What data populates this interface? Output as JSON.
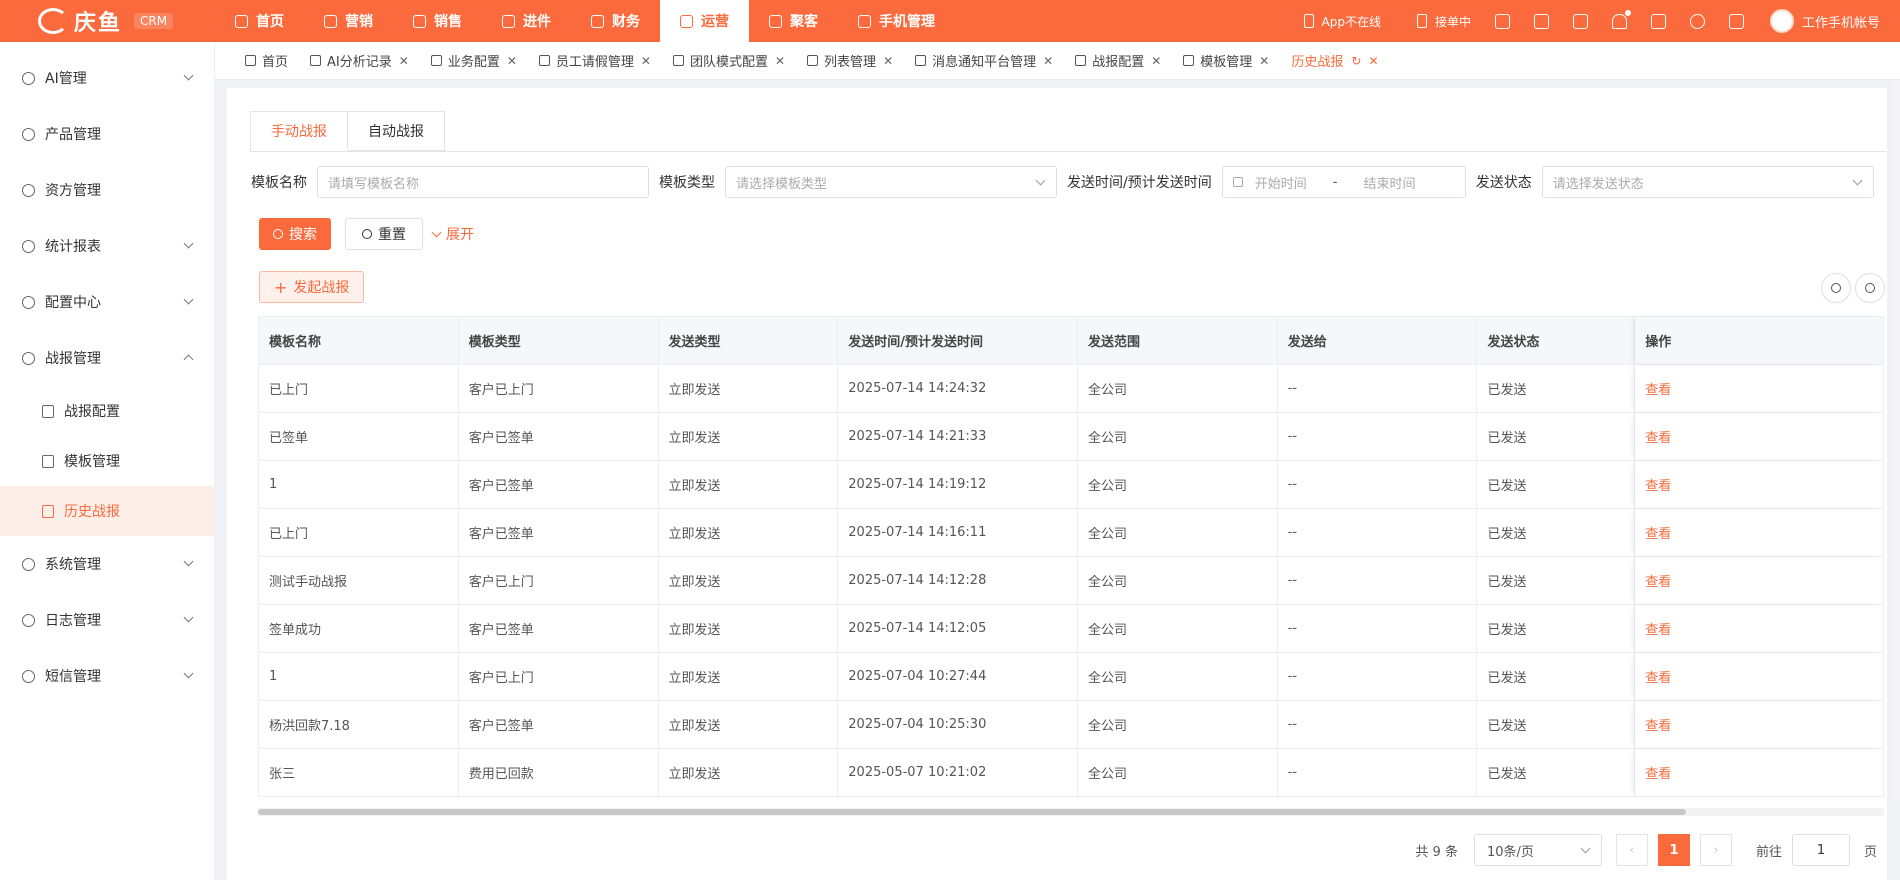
{
  "app": {
    "logo_text": "庆鱼",
    "badge": "CRM"
  },
  "topnav": [
    {
      "label": "首页"
    },
    {
      "label": "营销"
    },
    {
      "label": "销售"
    },
    {
      "label": "进件"
    },
    {
      "label": "财务"
    },
    {
      "label": "运营"
    },
    {
      "label": "聚客"
    },
    {
      "label": "手机管理"
    }
  ],
  "topright": {
    "app_status": "App不在线",
    "order_status": "接单中",
    "account": "工作手机帐号"
  },
  "sidebar": {
    "items": [
      {
        "label": "AI管理"
      },
      {
        "label": "产品管理"
      },
      {
        "label": "资方管理"
      },
      {
        "label": "统计报表"
      },
      {
        "label": "配置中心"
      },
      {
        "label": "战报管理"
      }
    ],
    "sub_items": [
      {
        "label": "战报配置"
      },
      {
        "label": "模板管理"
      },
      {
        "label": "历史战报"
      }
    ],
    "bottom_items": [
      {
        "label": "系统管理"
      },
      {
        "label": "日志管理"
      },
      {
        "label": "短信管理"
      }
    ]
  },
  "page_tabs": [
    {
      "label": "首页"
    },
    {
      "label": "AI分析记录"
    },
    {
      "label": "业务配置"
    },
    {
      "label": "员工请假管理"
    },
    {
      "label": "团队模式配置"
    },
    {
      "label": "列表管理"
    },
    {
      "label": "消息通知平台管理"
    },
    {
      "label": "战报配置"
    },
    {
      "label": "模板管理"
    },
    {
      "label": "历史战报"
    }
  ],
  "subtabs": {
    "manual": "手动战报",
    "auto": "自动战报"
  },
  "filters": {
    "template_name_label": "模板名称",
    "template_name_placeholder": "请填写模板名称",
    "template_type_label": "模板类型",
    "template_type_placeholder": "请选择模板类型",
    "time_label": "发送时间/预计发送时间",
    "start_placeholder": "开始时间",
    "separator": "-",
    "end_placeholder": "结束时间",
    "status_label": "发送状态",
    "status_placeholder": "请选择发送状态"
  },
  "buttons": {
    "search": "搜索",
    "reset": "重置",
    "expand": "展开",
    "launch": "发起战报"
  },
  "table": {
    "headers": [
      "模板名称",
      "模板类型",
      "发送类型",
      "发送时间/预计发送时间",
      "发送范围",
      "发送给",
      "发送状态",
      "操作"
    ],
    "rows": [
      [
        "已上门",
        "客户已上门",
        "立即发送",
        "2025-07-14 14:24:32",
        "全公司",
        "--",
        "已发送",
        "查看"
      ],
      [
        "已签单",
        "客户已签单",
        "立即发送",
        "2025-07-14 14:21:33",
        "全公司",
        "--",
        "已发送",
        "查看"
      ],
      [
        "1",
        "客户已签单",
        "立即发送",
        "2025-07-14 14:19:12",
        "全公司",
        "--",
        "已发送",
        "查看"
      ],
      [
        "已上门",
        "客户已签单",
        "立即发送",
        "2025-07-14 14:16:11",
        "全公司",
        "--",
        "已发送",
        "查看"
      ],
      [
        "测试手动战报",
        "客户已上门",
        "立即发送",
        "2025-07-14 14:12:28",
        "全公司",
        "--",
        "已发送",
        "查看"
      ],
      [
        "签单成功",
        "客户已签单",
        "立即发送",
        "2025-07-14 14:12:05",
        "全公司",
        "--",
        "已发送",
        "查看"
      ],
      [
        "1",
        "客户已上门",
        "立即发送",
        "2025-07-04 10:27:44",
        "全公司",
        "--",
        "已发送",
        "查看"
      ],
      [
        "杨洪回款7.18",
        "客户已签单",
        "立即发送",
        "2025-07-04 10:25:30",
        "全公司",
        "--",
        "已发送",
        "查看"
      ],
      [
        "张三",
        "费用已回款",
        "立即发送",
        "2025-05-07 10:21:02",
        "全公司",
        "--",
        "已发送",
        "查看"
      ]
    ]
  },
  "pagination": {
    "total": "共 9 条",
    "page_size": "10条/页",
    "current": "1",
    "goto_label": "前往",
    "goto_value": "1",
    "page_suffix": "页"
  },
  "colors": {
    "accent": "#fa6a3c"
  }
}
